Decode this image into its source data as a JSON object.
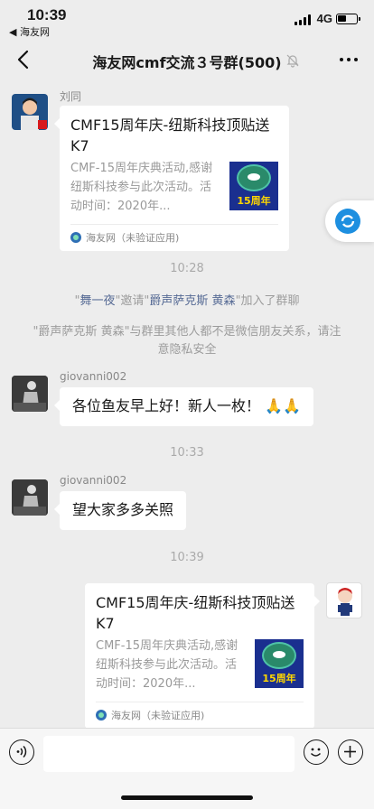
{
  "status_bar": {
    "time": "10:39",
    "back_app": "◀ 海友网",
    "network": "4G"
  },
  "nav": {
    "title": "海友网cmf交流３号群(500)"
  },
  "messages": {
    "m1": {
      "sender": "刘同",
      "card_title": "CMF15周年庆-纽斯科技顶贴送K7",
      "card_desc": "CMF-15周年庆典活动,感谢纽斯科技参与此次活动。活动时间：2020年...",
      "thumb_text": "15周年",
      "source": "海友网（未验证应用)"
    },
    "ts1": "10:28",
    "sys1": {
      "q1": "\"",
      "user1": "舞一夜",
      "q2": "\"邀请\"",
      "user2": "爵声萨克斯  黄森",
      "q3": "\"加入了群聊"
    },
    "sys2": "\"爵声萨克斯  黄森\"与群里其他人都不是微信朋友关系，请注意隐私安全",
    "m2": {
      "sender": "giovanni002",
      "text": "各位鱼友早上好！新人一枚！"
    },
    "ts2": "10:33",
    "m3": {
      "sender": "giovanni002",
      "text": "望大家多多关照"
    },
    "ts3": "10:39",
    "m4": {
      "card_title": "CMF15周年庆-纽斯科技顶贴送K7",
      "card_desc": "CMF-15周年庆典活动,感谢纽斯科技参与此次活动。活动时间：2020年...",
      "thumb_text": "15周年",
      "source": "海友网（未验证应用)"
    }
  },
  "input_bar": {
    "placeholder": ""
  },
  "colors": {
    "background": "#ededed",
    "link": "#576b95",
    "bubble": "#ffffff"
  }
}
